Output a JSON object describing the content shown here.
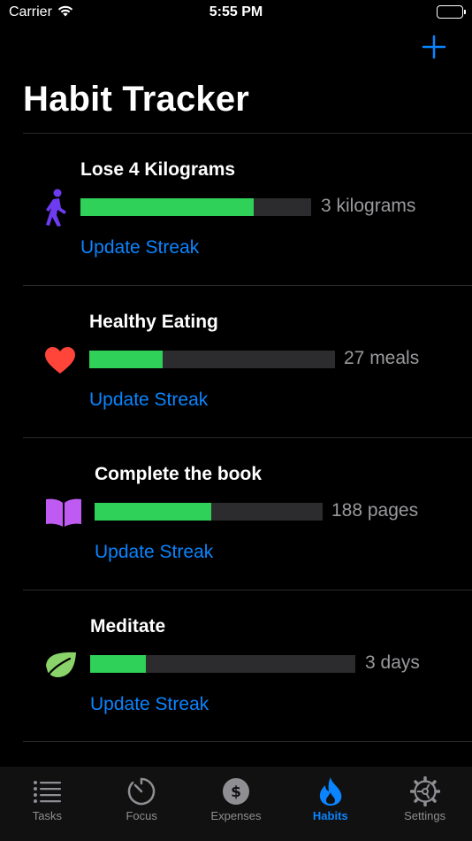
{
  "status_bar": {
    "carrier": "Carrier",
    "time": "5:55 PM"
  },
  "header": {
    "title": "Habit Tracker",
    "add_icon": "plus-icon"
  },
  "habits": [
    {
      "name": "Lose 4 Kilograms",
      "icon": "walking-person-icon",
      "icon_color": "#6d3bf0",
      "progress": 0.75,
      "value": "3 kilograms",
      "action": "Update Streak"
    },
    {
      "name": "Healthy Eating",
      "icon": "heart-icon",
      "icon_color": "#ff453a",
      "progress": 0.3,
      "value": "27 meals",
      "action": "Update Streak"
    },
    {
      "name": "Complete the book",
      "icon": "book-icon",
      "icon_color": "#bf5af2",
      "progress": 0.51,
      "value": "188 pages",
      "action": "Update Streak"
    },
    {
      "name": "Meditate",
      "icon": "leaf-icon",
      "icon_color": "#8ad36a",
      "progress": 0.21,
      "value": "3 days",
      "action": "Update Streak"
    }
  ],
  "tab_bar": {
    "tabs": [
      {
        "label": "Tasks",
        "icon": "list-icon",
        "active": false
      },
      {
        "label": "Focus",
        "icon": "timer-icon",
        "active": false
      },
      {
        "label": "Expenses",
        "icon": "dollar-circle-icon",
        "active": false
      },
      {
        "label": "Habits",
        "icon": "flame-icon",
        "active": true
      },
      {
        "label": "Settings",
        "icon": "gear-icon",
        "active": false
      }
    ]
  },
  "colors": {
    "accent": "#0a84ff",
    "progress_fill": "#30d158",
    "progress_track": "#2c2c2e",
    "background": "#000000"
  }
}
